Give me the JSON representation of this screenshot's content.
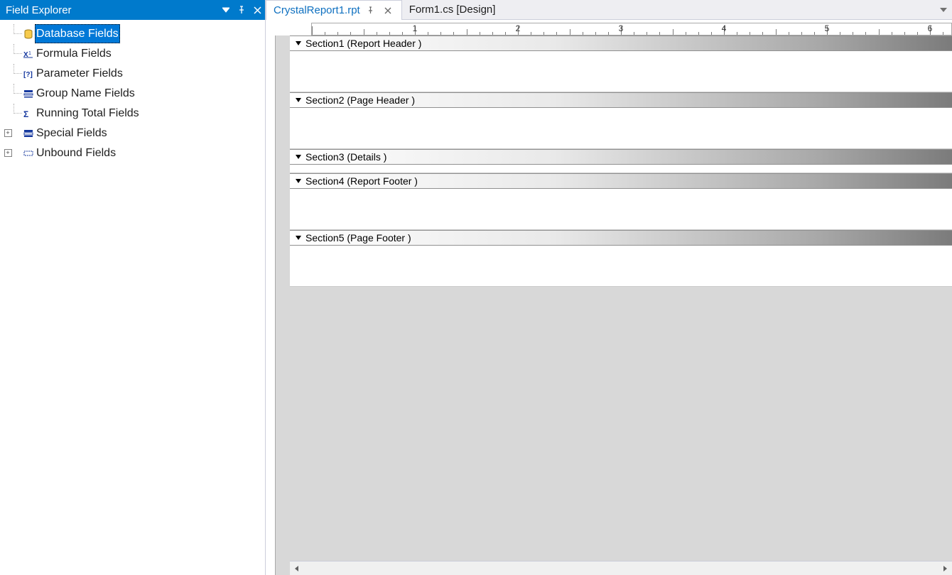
{
  "sidebar": {
    "title": "Field Explorer",
    "items": [
      {
        "label": "Database Fields",
        "icon": "database",
        "expander": null,
        "selected": true
      },
      {
        "label": "Formula Fields",
        "icon": "formula",
        "expander": null,
        "selected": false
      },
      {
        "label": "Parameter Fields",
        "icon": "parameter",
        "expander": null,
        "selected": false
      },
      {
        "label": "Group Name Fields",
        "icon": "group-name",
        "expander": null,
        "selected": false
      },
      {
        "label": "Running Total Fields",
        "icon": "running-total",
        "expander": null,
        "selected": false
      },
      {
        "label": "Special Fields",
        "icon": "special",
        "expander": "+",
        "selected": false
      },
      {
        "label": "Unbound Fields",
        "icon": "unbound",
        "expander": "+",
        "selected": false
      }
    ]
  },
  "tabs": {
    "active": "CrystalReport1.rpt",
    "inactive": "Form1.cs [Design]"
  },
  "ruler": {
    "numbers": [
      "1",
      "2",
      "3",
      "4",
      "5",
      "6"
    ]
  },
  "sections": [
    {
      "label": "Section1 (Report Header  )",
      "body_h": 58
    },
    {
      "label": "Section2 (Page Header  )",
      "body_h": 58
    },
    {
      "label": "Section3 (Details  )",
      "body_h": 12
    },
    {
      "label": "Section4 (Report Footer  )",
      "body_h": 58
    },
    {
      "label": "Section5 (Page Footer  )",
      "body_h": 58
    }
  ]
}
